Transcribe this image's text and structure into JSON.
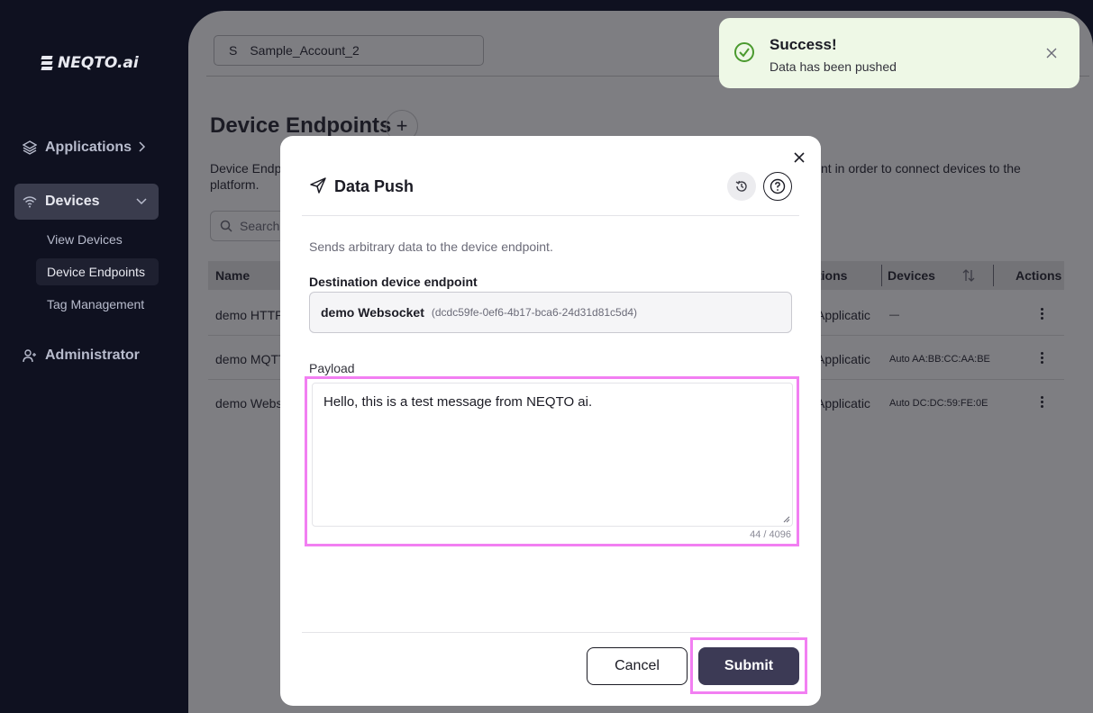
{
  "sidebar": {
    "logo": "NEQTO.ai",
    "nav": [
      {
        "label": "Applications",
        "icon": "layers-icon"
      },
      {
        "label": "Devices",
        "icon": "wifi-icon"
      },
      {
        "label": "Administrator",
        "icon": "user-icon"
      }
    ],
    "device_sub": [
      {
        "label": "View Devices"
      },
      {
        "label": "Device Endpoints"
      },
      {
        "label": "Tag Management"
      }
    ]
  },
  "header": {
    "account_initial": "S",
    "account_name": "Sample_Account_2"
  },
  "page": {
    "title": "Device Endpoints",
    "add_symbol": "+",
    "desc_left": "Device Endp platform.",
    "desc_right": "nt in order to connect devices to the",
    "desc_left_line1": "Device Endp",
    "desc_left_line2": "platform.",
    "search_placeholder": "Search"
  },
  "table": {
    "columns": {
      "name": "Name",
      "apps": "tions",
      "devices": "Devices",
      "actions": "Actions"
    },
    "rows": [
      {
        "name": "demo HTTP",
        "app": "t Applicatic",
        "devices": "—"
      },
      {
        "name": "demo MQTT",
        "app": "t Applicatic",
        "devices": "Auto AA:BB:CC:AA:BE"
      },
      {
        "name": "demo Webs",
        "app": "t Applicatic",
        "devices": "Auto DC:DC:59:FE:0E"
      }
    ]
  },
  "toast": {
    "title": "Success!",
    "message": "Data has been pushed",
    "color": "#eef8e6"
  },
  "modal": {
    "title": "Data Push",
    "description": "Sends arbitrary data to the device endpoint.",
    "dest_label": "Destination device endpoint",
    "dest_name": "demo Websocket",
    "dest_id": "(dcdc59fe-0ef6-4b17-bca6-24d31d81c5d4)",
    "payload_label": "Payload",
    "payload_value": "Hello, this is a test message from NEQTO ai.",
    "char_count": "44 / 4096",
    "cancel_label": "Cancel",
    "submit_label": "Submit",
    "highlight_color": "#f27ff2"
  }
}
